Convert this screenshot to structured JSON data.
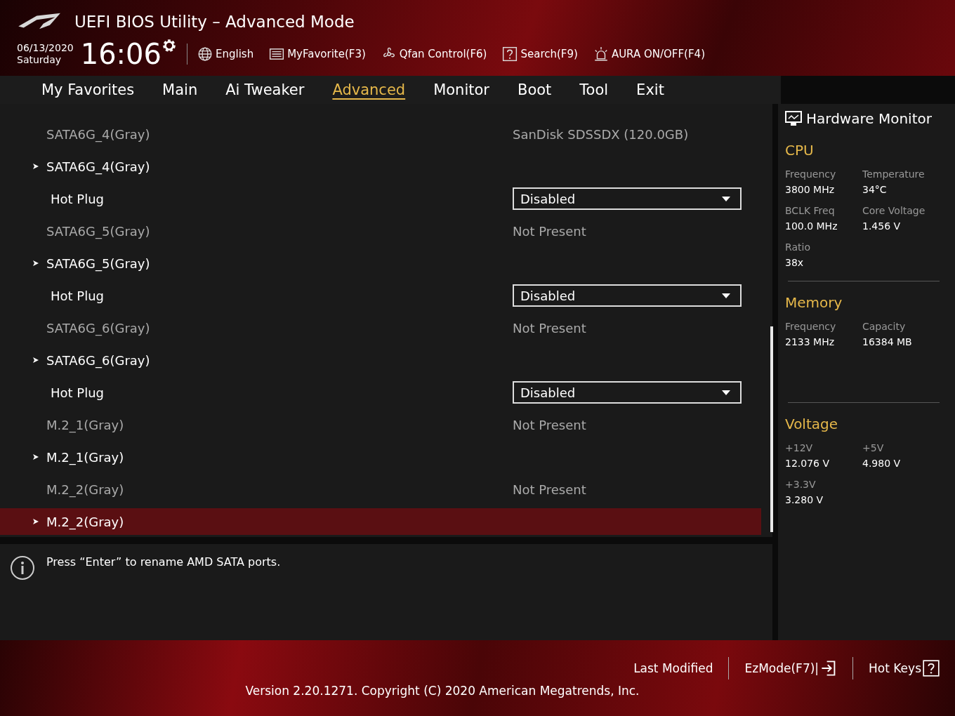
{
  "window": {
    "title": "UEFI BIOS Utility – Advanced Mode"
  },
  "clock": {
    "date": "06/13/2020",
    "day": "Saturday",
    "time": "16:06"
  },
  "toolbar": [
    {
      "kind": "globe",
      "label": "English"
    },
    {
      "kind": "favorite",
      "label": "MyFavorite(F3)"
    },
    {
      "kind": "fan",
      "label": "Qfan Control(F6)"
    },
    {
      "kind": "search",
      "label": "Search(F9)"
    },
    {
      "kind": "aura",
      "label": "AURA ON/OFF(F4)"
    }
  ],
  "tabs": [
    {
      "label": "My Favorites",
      "selected": false
    },
    {
      "label": "Main",
      "selected": false
    },
    {
      "label": "Ai Tweaker",
      "selected": false
    },
    {
      "label": "Advanced",
      "selected": true
    },
    {
      "label": "Monitor",
      "selected": false
    },
    {
      "label": "Boot",
      "selected": false
    },
    {
      "label": "Tool",
      "selected": false
    },
    {
      "label": "Exit",
      "selected": false
    }
  ],
  "settings": [
    {
      "kind": "info",
      "label": "SATA6G_4(Gray)",
      "value": "SanDisk SDSSDX (120.0GB)",
      "selected": false
    },
    {
      "kind": "submenu",
      "label": "SATA6G_4(Gray)",
      "selected": false
    },
    {
      "kind": "dropdown",
      "label": "Hot Plug",
      "value": "Disabled",
      "selected": false
    },
    {
      "kind": "info",
      "label": "SATA6G_5(Gray)",
      "value": "Not Present",
      "selected": false
    },
    {
      "kind": "submenu",
      "label": "SATA6G_5(Gray)",
      "selected": false
    },
    {
      "kind": "dropdown",
      "label": "Hot Plug",
      "value": "Disabled",
      "selected": false
    },
    {
      "kind": "info",
      "label": "SATA6G_6(Gray)",
      "value": "Not Present",
      "selected": false
    },
    {
      "kind": "submenu",
      "label": "SATA6G_6(Gray)",
      "selected": false
    },
    {
      "kind": "dropdown",
      "label": "Hot Plug",
      "value": "Disabled",
      "selected": false
    },
    {
      "kind": "info",
      "label": "M.2_1(Gray)",
      "value": "Not Present",
      "selected": false
    },
    {
      "kind": "submenu",
      "label": "M.2_1(Gray)",
      "selected": false
    },
    {
      "kind": "info",
      "label": "M.2_2(Gray)",
      "value": "Not Present",
      "selected": false
    },
    {
      "kind": "submenu",
      "label": "M.2_2(Gray)",
      "selected": true
    }
  ],
  "help": {
    "text": "Press “Enter” to rename AMD SATA ports."
  },
  "hardware_monitor": {
    "title": "Hardware Monitor",
    "sections": [
      {
        "title": "CPU",
        "items": [
          {
            "label": "Frequency",
            "value": "3800 MHz"
          },
          {
            "label": "Temperature",
            "value": "34°C"
          },
          {
            "label": "BCLK Freq",
            "value": "100.0 MHz"
          },
          {
            "label": "Core Voltage",
            "value": "1.456 V"
          },
          {
            "label": "Ratio",
            "value": "38x"
          }
        ]
      },
      {
        "title": "Memory",
        "items": [
          {
            "label": "Frequency",
            "value": "2133 MHz"
          },
          {
            "label": "Capacity",
            "value": "16384 MB"
          }
        ]
      },
      {
        "title": "Voltage",
        "items": [
          {
            "label": "+12V",
            "value": "12.076 V"
          },
          {
            "label": "+5V",
            "value": "4.980 V"
          },
          {
            "label": "+3.3V",
            "value": "3.280 V"
          }
        ]
      }
    ]
  },
  "footer": {
    "actions": [
      {
        "kind": "text",
        "label": "Last Modified"
      },
      {
        "kind": "exit",
        "label": "EzMode(F7)|"
      },
      {
        "kind": "help",
        "label": "Hot Keys"
      }
    ],
    "version": "Version 2.20.1271. Copyright (C) 2020 American Megatrends, Inc."
  }
}
